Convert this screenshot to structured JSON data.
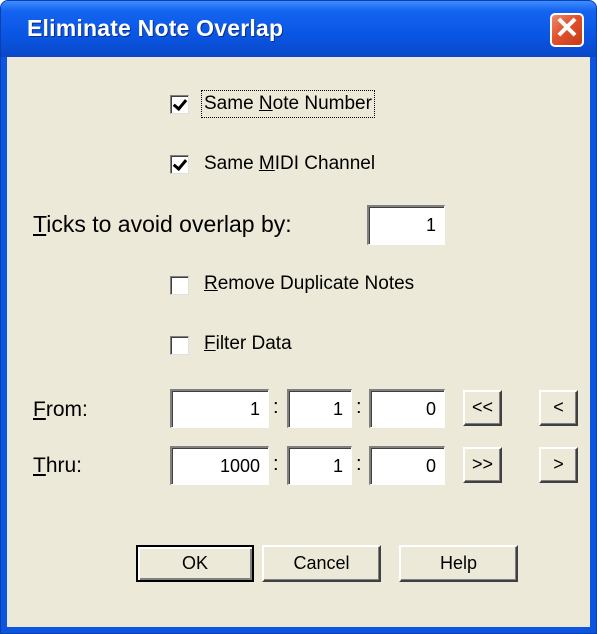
{
  "window": {
    "title": "Eliminate Note Overlap"
  },
  "options": {
    "same_note_number": {
      "pre": "Same ",
      "u": "N",
      "post": "ote Number",
      "checked": true
    },
    "same_midi_channel": {
      "pre": "Same ",
      "u": "M",
      "post": "IDI Channel",
      "checked": true
    },
    "remove_duplicates": {
      "pre": "",
      "u": "R",
      "post": "emove Duplicate Notes",
      "checked": false
    },
    "filter_data": {
      "pre": "",
      "u": "F",
      "post": "ilter Data",
      "checked": false
    }
  },
  "ticks": {
    "u": "T",
    "post": "icks to avoid overlap by:",
    "value": "1"
  },
  "from": {
    "u": "F",
    "post": "rom:",
    "bar": "1",
    "beat": "1",
    "tick": "0",
    "btn_first": "<<",
    "btn_prev": "<"
  },
  "thru": {
    "u": "T",
    "post": "hru:",
    "bar": "1000",
    "beat": "1",
    "tick": "0",
    "btn_last": ">>",
    "btn_next": ">"
  },
  "separator": ":",
  "buttons": {
    "ok": "OK",
    "cancel": "Cancel",
    "help": "Help"
  },
  "icons": {
    "close": "close-icon"
  }
}
